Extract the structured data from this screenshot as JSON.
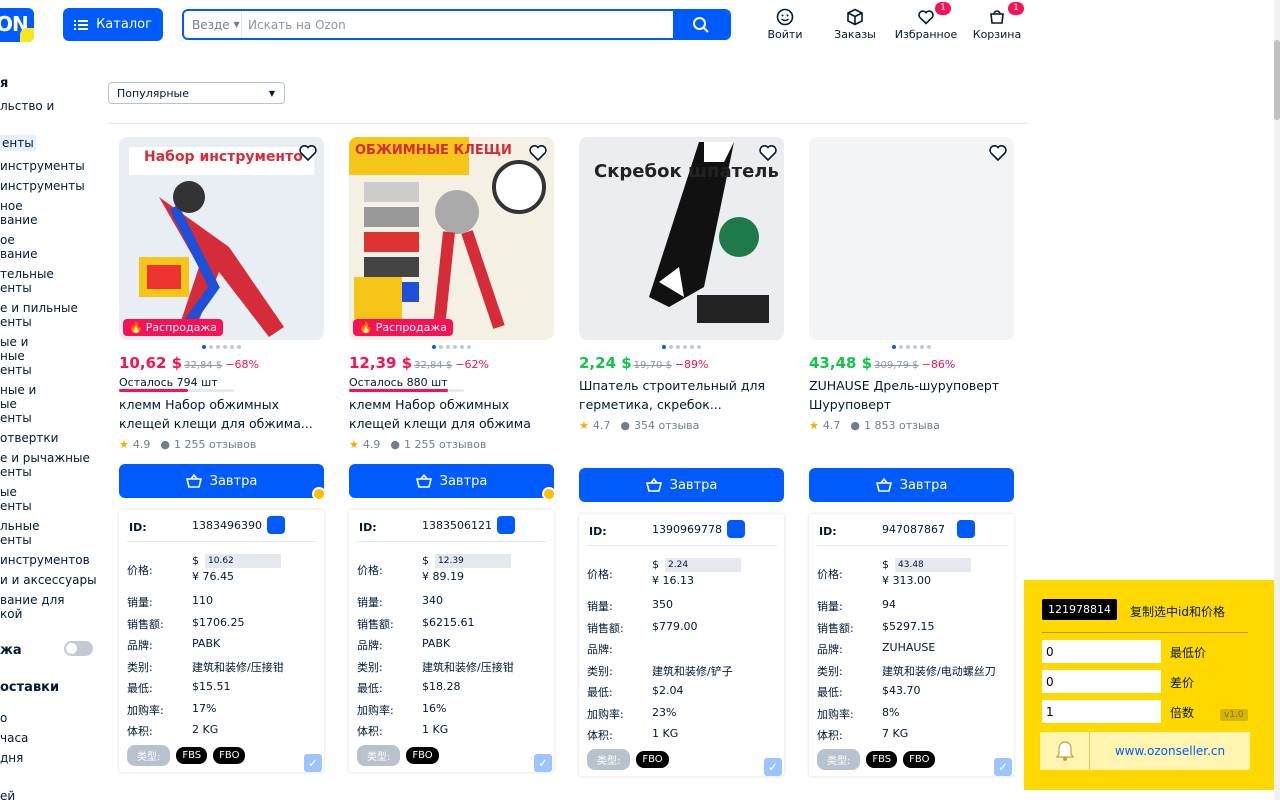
{
  "header": {
    "logo": "ON",
    "catalog": "Каталог",
    "search_scope": "Везде",
    "search_placeholder": "Искать на Ozon",
    "actions": [
      {
        "label": "Войти",
        "icon": "smile-icon",
        "badge": ""
      },
      {
        "label": "Заказы",
        "icon": "box-icon",
        "badge": ""
      },
      {
        "label": "Избранное",
        "icon": "heart-icon",
        "badge": "1"
      },
      {
        "label": "Корзина",
        "icon": "cart-icon",
        "badge": "1"
      }
    ]
  },
  "sidebar": {
    "items": [
      "я",
      "льство и",
      "енты",
      "инструменты",
      "инструменты",
      "ное",
      "вание",
      "ое",
      "вание",
      "тельные",
      "енты",
      "е и пильные",
      "енты",
      "ые и",
      "ные",
      "енты",
      "ные и",
      "ые",
      "енты",
      "отвертки",
      "е и рычажные",
      "енты",
      "ые",
      "енты",
      "льные",
      "енты",
      "инструментов",
      "и и аксессуары",
      "вание для",
      "кой"
    ],
    "sale_label": "жа",
    "delivery_label": "оставки",
    "delivery_items": [
      "о",
      "часа",
      "дня",
      "ей"
    ]
  },
  "sort": {
    "selected": "Популярные"
  },
  "products": [
    {
      "price": "10,62 $",
      "old": "32,84 $",
      "disc": "−68%",
      "price_color": "#f91155",
      "left": "Осталось 794 шт",
      "left_frac": 0.6,
      "title": "клемм Набор обжимных клещей клещи для обжима...",
      "rating": "4.9",
      "reviews": "1 255 отзывов",
      "sale": "Распродажа",
      "img_title": "Набор инструменто",
      "cart": "Завтра",
      "info": {
        "id": "1383496390",
        "usd": "$",
        "usd_v": "10.62",
        "cny": "¥ 76.45",
        "sales": "110",
        "revenue": "$1706.25",
        "brand": "PABK",
        "cat": "建筑和装修/压接钳",
        "min": "$15.51",
        "rate": "17%",
        "vol": "2 KG",
        "types": [
          "FBS",
          "FBO"
        ]
      }
    },
    {
      "price": "12,39 $",
      "old": "32,84 $",
      "disc": "−62%",
      "price_color": "#f91155",
      "left": "Осталось 880 шт",
      "left_frac": 0.86,
      "title": "клемм Набор обжимных клещей клещи для обжима",
      "rating": "4.9",
      "reviews": "1 255 отзывов",
      "sale": "Распродажа",
      "img_title": "ОБЖИМНЫЕ КЛЕЩИ",
      "cart": "Завтра",
      "info": {
        "id": "1383506121",
        "usd": "$",
        "usd_v": "12.39",
        "cny": "¥ 89.19",
        "sales": "340",
        "revenue": "$6215.61",
        "brand": "PABK",
        "cat": "建筑和装修/压接钳",
        "min": "$18.28",
        "rate": "16%",
        "vol": "1 KG",
        "types": [
          "FBO"
        ]
      }
    },
    {
      "price": "2,24 $",
      "old": "19,70 $",
      "disc": "−89%",
      "price_color": "#10c44c",
      "left": "",
      "left_frac": 0,
      "title": "Шпатель строительный для герметика, скребок...",
      "rating": "4.7",
      "reviews": "354 отзыва",
      "sale": "",
      "img_title": "Скребок шпатель",
      "cart": "Завтра",
      "info": {
        "id": "1390969778",
        "usd": "$",
        "usd_v": "2.24",
        "cny": "¥ 16.13",
        "sales": "350",
        "revenue": "$779.00",
        "brand": "",
        "cat": "建筑和装修/铲子",
        "min": "$2.04",
        "rate": "23%",
        "vol": "1 KG",
        "types": [
          "FBO"
        ]
      }
    },
    {
      "price": "43,48 $",
      "old": "309,79 $",
      "disc": "−86%",
      "price_color": "#10c44c",
      "left": "",
      "left_frac": 0,
      "title": "ZUHAUSE Дрель-шуруповерт Шуруповерт аккумуляторный...",
      "rating": "4.7",
      "reviews": "1 853 отзыва",
      "sale": "",
      "img_title": "",
      "cart": "Завтра",
      "info": {
        "id": "947087867",
        "usd": "$",
        "usd_v": "43.48",
        "cny": "¥ 313.00",
        "sales": "94",
        "revenue": "$5297.15",
        "brand": "ZUHAUSE",
        "cat": "建筑和装修/电动螺丝刀",
        "min": "$43.70",
        "rate": "8%",
        "vol": "7 KG",
        "types": [
          "FBS",
          "FBO"
        ]
      }
    }
  ],
  "labels": {
    "id": "ID:",
    "price": "价格:",
    "sales": "销量:",
    "revenue": "销售额:",
    "brand": "品牌:",
    "cat": "类别:",
    "min": "最低:",
    "rate": "加购率:",
    "vol": "体积:",
    "type": "类型:"
  },
  "panel": {
    "id": "121978814",
    "copy": "复制选中id和价格",
    "f1": "0",
    "f1_label": "最低价",
    "f2": "0",
    "f2_label": "差价",
    "f3": "1",
    "f3_label": "倍数",
    "version": "v1.0",
    "url": "www.ozonseller.cn"
  }
}
